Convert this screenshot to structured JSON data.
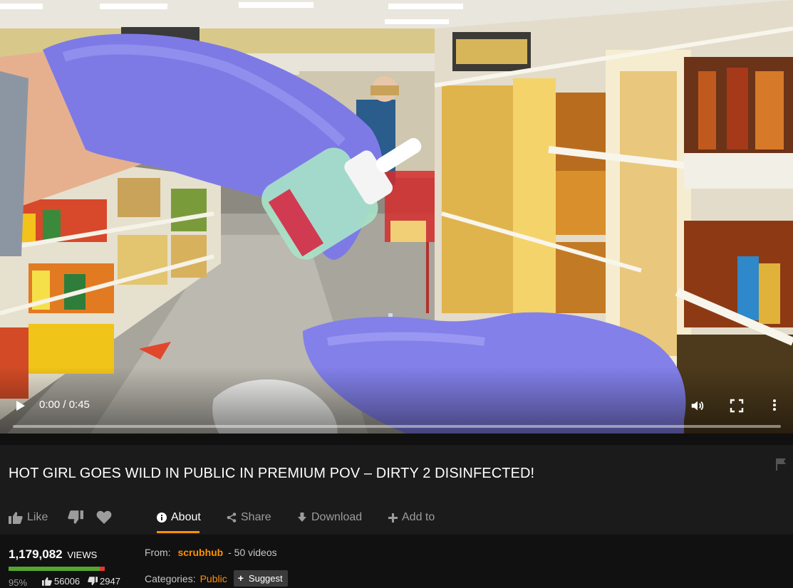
{
  "video": {
    "current_time": "0:00",
    "duration": "0:45",
    "time_display": "0:00 / 0:45",
    "progress": 0
  },
  "title": "HOT GIRL GOES WILD IN PUBLIC IN PREMIUM POV – DIRTY 2 DISINFECTED!",
  "actions": {
    "like_label": "Like",
    "tabs": [
      {
        "label": "About",
        "active": true,
        "icon": "info-icon"
      },
      {
        "label": "Share",
        "active": false,
        "icon": "share-icon"
      },
      {
        "label": "Download",
        "active": false,
        "icon": "download-icon"
      },
      {
        "label": "Add to",
        "active": false,
        "icon": "plus-icon"
      }
    ]
  },
  "stats": {
    "views": "1,179,082",
    "views_label": "VIEWS",
    "rating_percent": "95%",
    "rating_fraction": 0.95,
    "likes": "56006",
    "dislikes": "2947"
  },
  "info": {
    "from_label": "From:",
    "channel": "scrubhub",
    "videos": "- 50 videos",
    "categories_label": "Categories:",
    "category": "Public",
    "suggest_label": "Suggest"
  },
  "colors": {
    "accent": "#ff9000",
    "background": "#1b1b1b",
    "rating_good": "#55a630",
    "rating_bad": "#e03a2f"
  }
}
